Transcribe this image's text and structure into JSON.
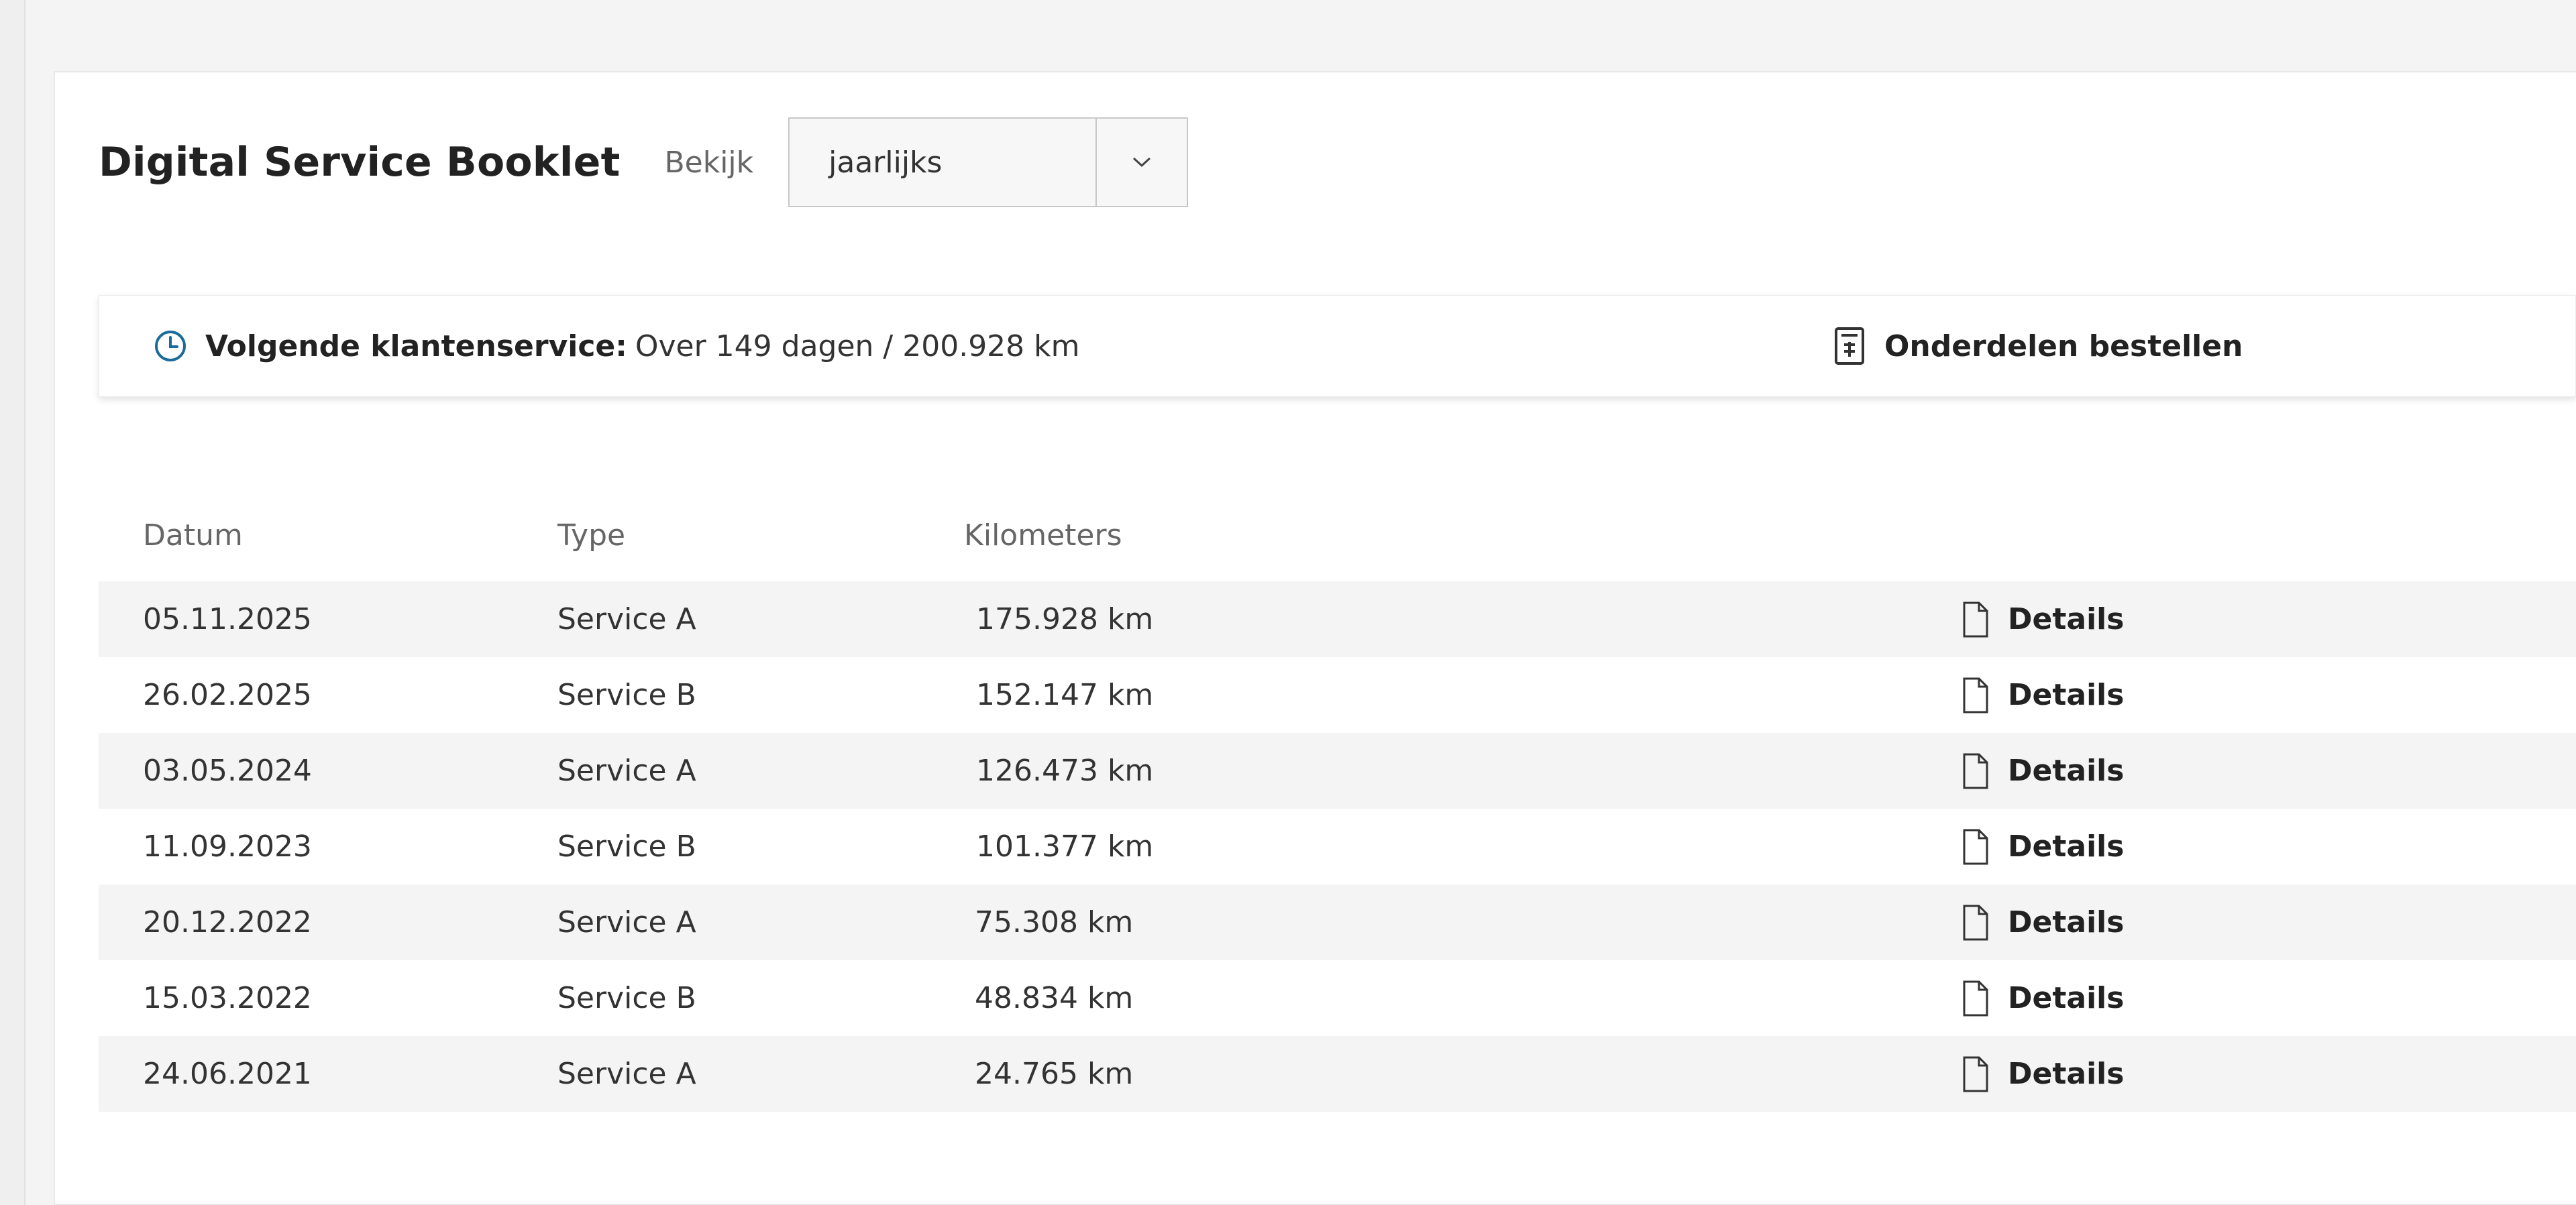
{
  "header": {
    "title": "Digital Service Booklet",
    "view_label": "Bekijk",
    "view_selected": "jaarlijks"
  },
  "info_bar": {
    "next_service_label": "Volgende klantenservice:",
    "next_service_value": "Over 149 dagen / 200.928 km",
    "order_parts_label": "Onderdelen bestellen"
  },
  "table": {
    "columns": [
      "Datum",
      "Type",
      "Kilometers"
    ],
    "rows": [
      {
        "date": "05.11.2025",
        "type": "Service A",
        "km": "175.928 km",
        "action": "Details"
      },
      {
        "date": "26.02.2025",
        "type": "Service B",
        "km": "152.147 km",
        "action": "Details"
      },
      {
        "date": "03.05.2024",
        "type": "Service A",
        "km": "126.473 km",
        "action": "Details"
      },
      {
        "date": "11.09.2023",
        "type": "Service B",
        "km": "101.377 km",
        "action": "Details"
      },
      {
        "date": "20.12.2022",
        "type": "Service A",
        "km": "75.308 km",
        "action": "Details"
      },
      {
        "date": "15.03.2022",
        "type": "Service B",
        "km": "48.834 km",
        "action": "Details"
      },
      {
        "date": "24.06.2021",
        "type": "Service A",
        "km": "24.765 km",
        "action": "Details"
      }
    ]
  },
  "icons": {
    "clock": "clock-icon",
    "parts": "parts-list-icon",
    "document": "document-icon",
    "chevron": "chevron-down-icon"
  },
  "colors": {
    "accent": "#1a6b9a",
    "row_alt": "#f4f4f4"
  }
}
